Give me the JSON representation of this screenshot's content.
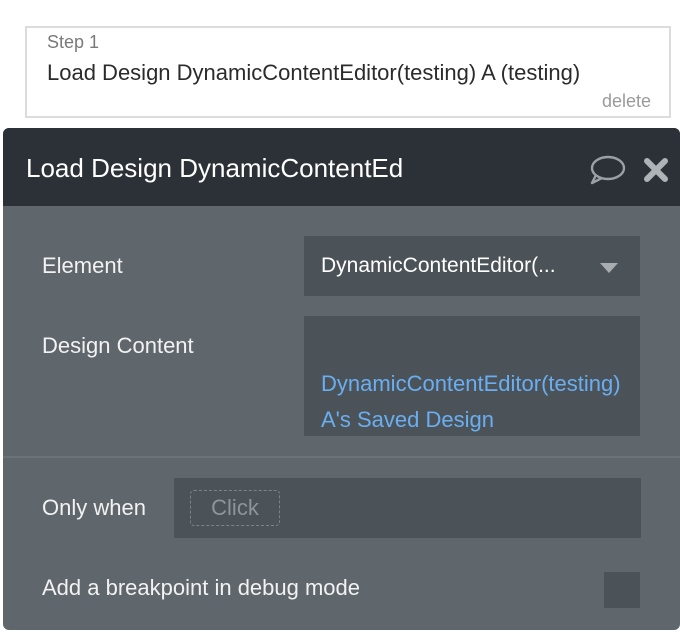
{
  "step": {
    "label": "Step 1",
    "title": "Load Design DynamicContentEditor(testing) A (testing)",
    "delete_label": "delete"
  },
  "panel": {
    "title": "Load Design DynamicContentEd",
    "icons": {
      "comment": "comment-icon",
      "close": "close-icon"
    },
    "element": {
      "label": "Element",
      "value": "DynamicContentEditor(..."
    },
    "design_content": {
      "label": "Design Content",
      "value": "DynamicContentEditor(testing) A's Saved Design"
    },
    "only_when": {
      "label": "Only when",
      "placeholder": "Click"
    },
    "breakpoint": {
      "label": "Add a breakpoint in debug mode",
      "checked": false
    }
  },
  "colors": {
    "panel_bg": "#5f666c",
    "header_bg": "#2b3136",
    "field_bg": "#4c5358",
    "link": "#6aaef2"
  }
}
